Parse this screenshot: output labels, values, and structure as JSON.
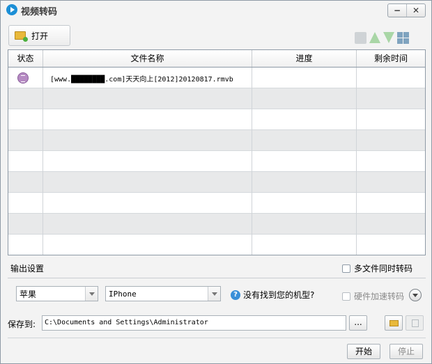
{
  "window": {
    "title": "视频转码",
    "minimize_label": "−",
    "close_label": "✕"
  },
  "toolbar": {
    "open_label": "打开",
    "icons": [
      "folder-add-icon",
      "trash-icon",
      "arrow-up-icon",
      "arrow-down-icon",
      "grid-icon"
    ]
  },
  "table": {
    "headers": [
      "状态",
      "文件名称",
      "进度",
      "剩余时间"
    ],
    "rows": [
      {
        "status_icon": "waiting-hourglass-icon",
        "filename": "[www.████████.com]天天向上[2012]20120817.rmvb",
        "progress": "",
        "remaining": ""
      }
    ],
    "empty_row_count": 8
  },
  "output": {
    "section_label": "输出设置",
    "multi_file_label": "多文件同时转码",
    "brand_value": "苹果",
    "model_value": "IPhone",
    "help_label": "没有找到您的机型?",
    "hw_accel_label": "硬件加速转码"
  },
  "save": {
    "label": "保存到:",
    "path": "C:\\Documents and Settings\\Administrator",
    "browse_label": "..."
  },
  "actions": {
    "start_label": "开始",
    "stop_label": "停止"
  }
}
